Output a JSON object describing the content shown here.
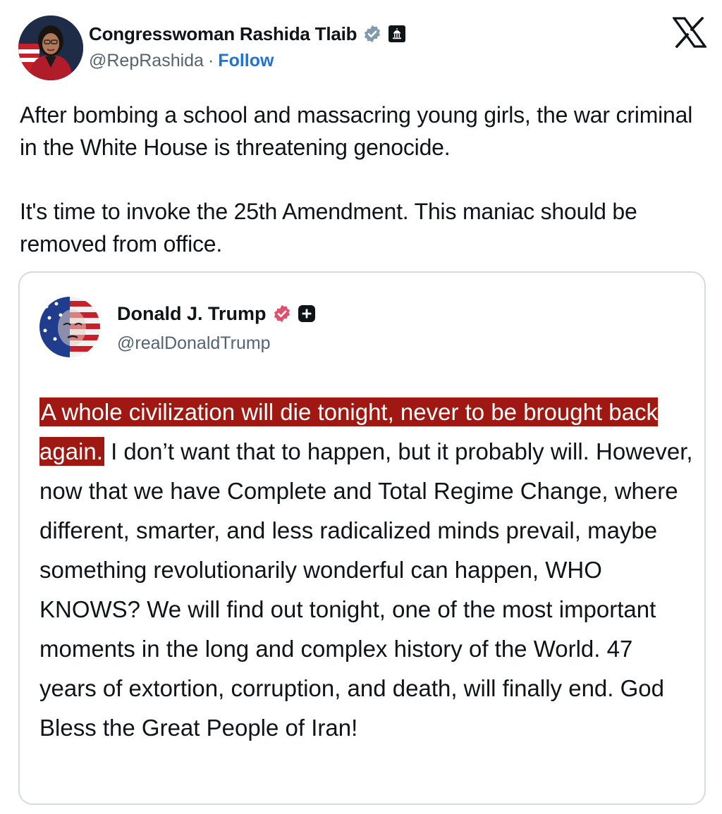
{
  "post": {
    "author": {
      "display_name": "Congresswoman Rashida Tlaib",
      "handle": "@RepRashida",
      "separator": "·",
      "follow_label": "Follow"
    },
    "paragraphs": [
      "After bombing a school and massacring young girls, the war criminal in the White House is threatening genocide.",
      "It's time to invoke the 25th Amendment. This maniac should be removed from office."
    ]
  },
  "quoted": {
    "author": {
      "display_name": "Donald J. Trump",
      "handle": "@realDonaldTrump"
    },
    "highlighted_text": "A whole civilization will die tonight, never to be brought back again.",
    "body_text": " I don’t want that to happen, but it probably will. However, now that we have Complete and Total Regime Change, where different, smarter, and less radicalized minds prevail, maybe something revolutionarily wonderful can happen, WHO KNOWS? We will find out tonight, one of the most important moments in the long and complex history of the World. 47 years of extortion, corruption, and death, will finally end. God Bless the Great People of Iran!"
  },
  "icons": {
    "verified_gray": "verified-badge-icon",
    "government": "capitol-icon",
    "verified_pink": "verified-badge-icon",
    "plus": "plus-badge-icon",
    "platform_logo": "x-logo-icon"
  },
  "colors": {
    "link": "#1d74d4",
    "secondary_text": "#536471",
    "highlight_background": "#a01812",
    "card_border": "#d6dbe0"
  }
}
